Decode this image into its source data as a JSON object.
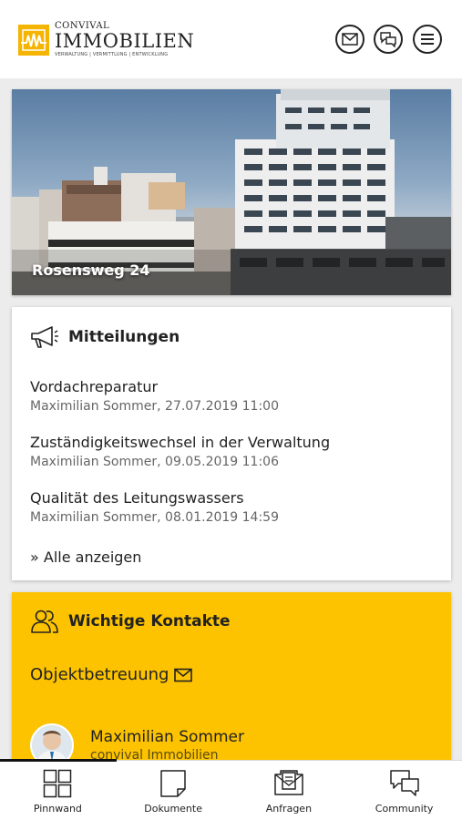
{
  "header": {
    "logo": {
      "small": "CONVIVAL",
      "big": "IMMOBILIEN",
      "tagline": "VERWALTUNG | VERMITTLUNG | ENTWICKLUNG"
    },
    "buttons": [
      "mail-icon",
      "chat-icon",
      "menu-icon"
    ]
  },
  "hero": {
    "title": "Rosensweg 24"
  },
  "messages": {
    "title": "Mitteilungen",
    "items": [
      {
        "title": "Vordachreparatur",
        "meta": "Maximilian Sommer, 27.07.2019 11:00"
      },
      {
        "title": "Zuständigkeitswechsel in der Verwaltung",
        "meta": "Maximilian Sommer, 09.05.2019 11:06"
      },
      {
        "title": "Qualität des Leitungswassers",
        "meta": "Maximilian Sommer, 08.01.2019 14:59"
      }
    ],
    "all_label": "» Alle anzeigen"
  },
  "contacts": {
    "title": "Wichtige Kontakte",
    "section_label": "Objektbetreuung",
    "person": {
      "name": "Maximilian Sommer",
      "company": "convival Immobilien"
    },
    "accent_color": "#fdc300"
  },
  "tabbar": {
    "tabs": [
      {
        "label": "Pinnwand",
        "icon": "grid-icon"
      },
      {
        "label": "Dokumente",
        "icon": "document-icon"
      },
      {
        "label": "Anfragen",
        "icon": "inquiry-icon"
      },
      {
        "label": "Community",
        "icon": "community-chat-icon"
      }
    ]
  }
}
